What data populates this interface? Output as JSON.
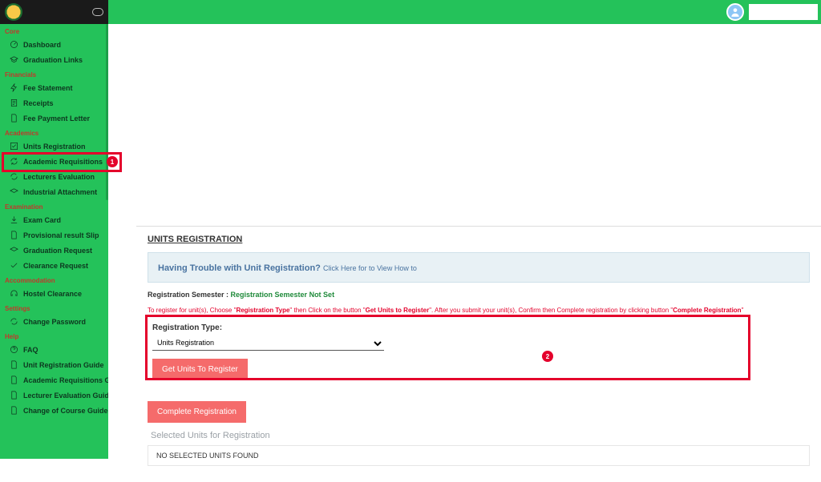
{
  "header": {
    "search_placeholder": ""
  },
  "sidebar": {
    "sections": [
      {
        "title": "Core",
        "items": [
          {
            "label": "Dashboard",
            "icon": "gauge"
          },
          {
            "label": "Graduation Links",
            "icon": "grad"
          }
        ]
      },
      {
        "title": "Financials",
        "items": [
          {
            "label": "Fee Statement",
            "icon": "bolt"
          },
          {
            "label": "Receipts",
            "icon": "receipt"
          },
          {
            "label": "Fee Payment Letter",
            "icon": "doc"
          }
        ]
      },
      {
        "title": "Academics",
        "items": [
          {
            "label": "Units Registration",
            "icon": "check"
          },
          {
            "label": "Academic Requisitions",
            "icon": "refresh"
          },
          {
            "label": "Lecturers Evaluation",
            "icon": "refresh"
          },
          {
            "label": "Industrial Attachment",
            "icon": "grad"
          }
        ]
      },
      {
        "title": "Examination",
        "items": [
          {
            "label": "Exam Card",
            "icon": "download"
          },
          {
            "label": "Provisional result Slip",
            "icon": "doc"
          },
          {
            "label": "Graduation Request",
            "icon": "grad"
          },
          {
            "label": "Clearance Request",
            "icon": "check2"
          }
        ]
      },
      {
        "title": "Accommodation",
        "items": [
          {
            "label": "Hostel Clearance",
            "icon": "home"
          }
        ]
      },
      {
        "title": "Settings",
        "items": [
          {
            "label": "Change Password",
            "icon": "refresh"
          }
        ]
      },
      {
        "title": "Help",
        "items": [
          {
            "label": "FAQ",
            "icon": "q"
          },
          {
            "label": "Unit Registration Guide",
            "icon": "doc"
          },
          {
            "label": "Academic Requisitions Guide",
            "icon": "doc"
          },
          {
            "label": "Lecturer Evaluation Guide",
            "icon": "doc"
          },
          {
            "label": "Change of Course Guide",
            "icon": "doc"
          }
        ]
      }
    ]
  },
  "annotations": {
    "marker1": "1",
    "marker2": "2"
  },
  "main": {
    "title": "UNITS REGISTRATION",
    "help_bold": "Having Trouble with Unit Registration? ",
    "help_rest": "Click Here for to View How to",
    "reg_sem_label": "Registration Semester : ",
    "reg_sem_value": "Registration Semester Not Set",
    "instr_p1": "To register for unit(s), Choose \"",
    "instr_b1": "Registration Type",
    "instr_p2": "\" then Click on the button \"",
    "instr_b2": "Get Units to Register",
    "instr_p3": "\". After you submit your unit(s), Confirm then Complete registration by clicking button \"",
    "instr_b3": "Complete Registration",
    "instr_p4": "\"",
    "form_label": "Registration Type:",
    "select_value": "Units Registration",
    "btn_get": "Get Units To Register",
    "btn_complete": "Complete Registration",
    "selected_heading": "Selected Units for Registration",
    "no_units": "NO SELECTED UNITS FOUND"
  }
}
